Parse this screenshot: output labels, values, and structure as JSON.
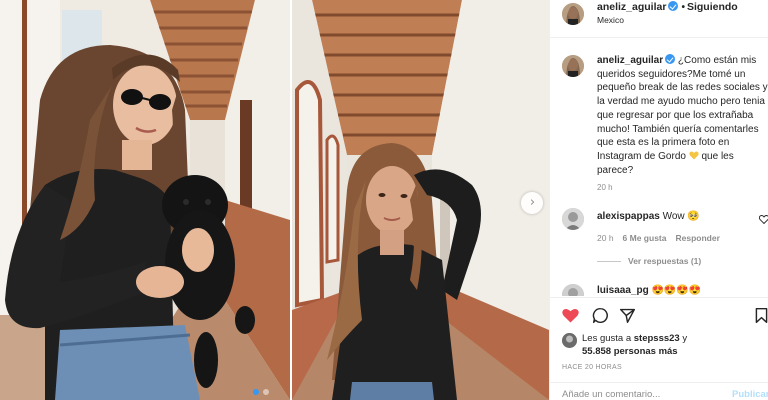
{
  "post": {
    "username": "aneliz_aguilar",
    "follow_status": "Siguiendo",
    "separator": "•",
    "location": "Mexico"
  },
  "caption": {
    "username": "aneliz_aguilar",
    "text": "¿Como están mis queridos seguidores?Me tomé un pequeño break de las redes sociales y la verdad me ayudo mucho pero tenia que regresar por que los extrañaba mucho! También quería comentarles que esta es la primera foto en Instagram de Gordo",
    "text_end": " que les parece?",
    "time": "20 h"
  },
  "comments": [
    {
      "username": "alexispappas",
      "text": "Wow 🥺",
      "time": "20 h",
      "likes": "6 Me gusta",
      "reply_label": "Responder",
      "view_replies": "Ver respuestas (1)"
    },
    {
      "username": "luisaaa_pg",
      "text": "😍😍😍😍"
    }
  ],
  "likes": {
    "prefix": "Les gusta a",
    "user": "stepsss23",
    "connector": "y",
    "others": "55.858 personas más"
  },
  "post_age": "Hace 20 horas",
  "add_comment": {
    "placeholder": "Añade un comentario...",
    "publish_label": "Publicar"
  },
  "icons": {
    "like": "heart-filled-icon",
    "comment": "comment-icon",
    "share": "send-icon",
    "save": "bookmark-icon",
    "next": "chevron-right-icon",
    "verified": "verified-badge-icon"
  },
  "colors": {
    "accent": "#3897f0",
    "like_red": "#ed4956",
    "muted": "#8e8e8e",
    "text": "#262626",
    "divider": "#efefef"
  }
}
